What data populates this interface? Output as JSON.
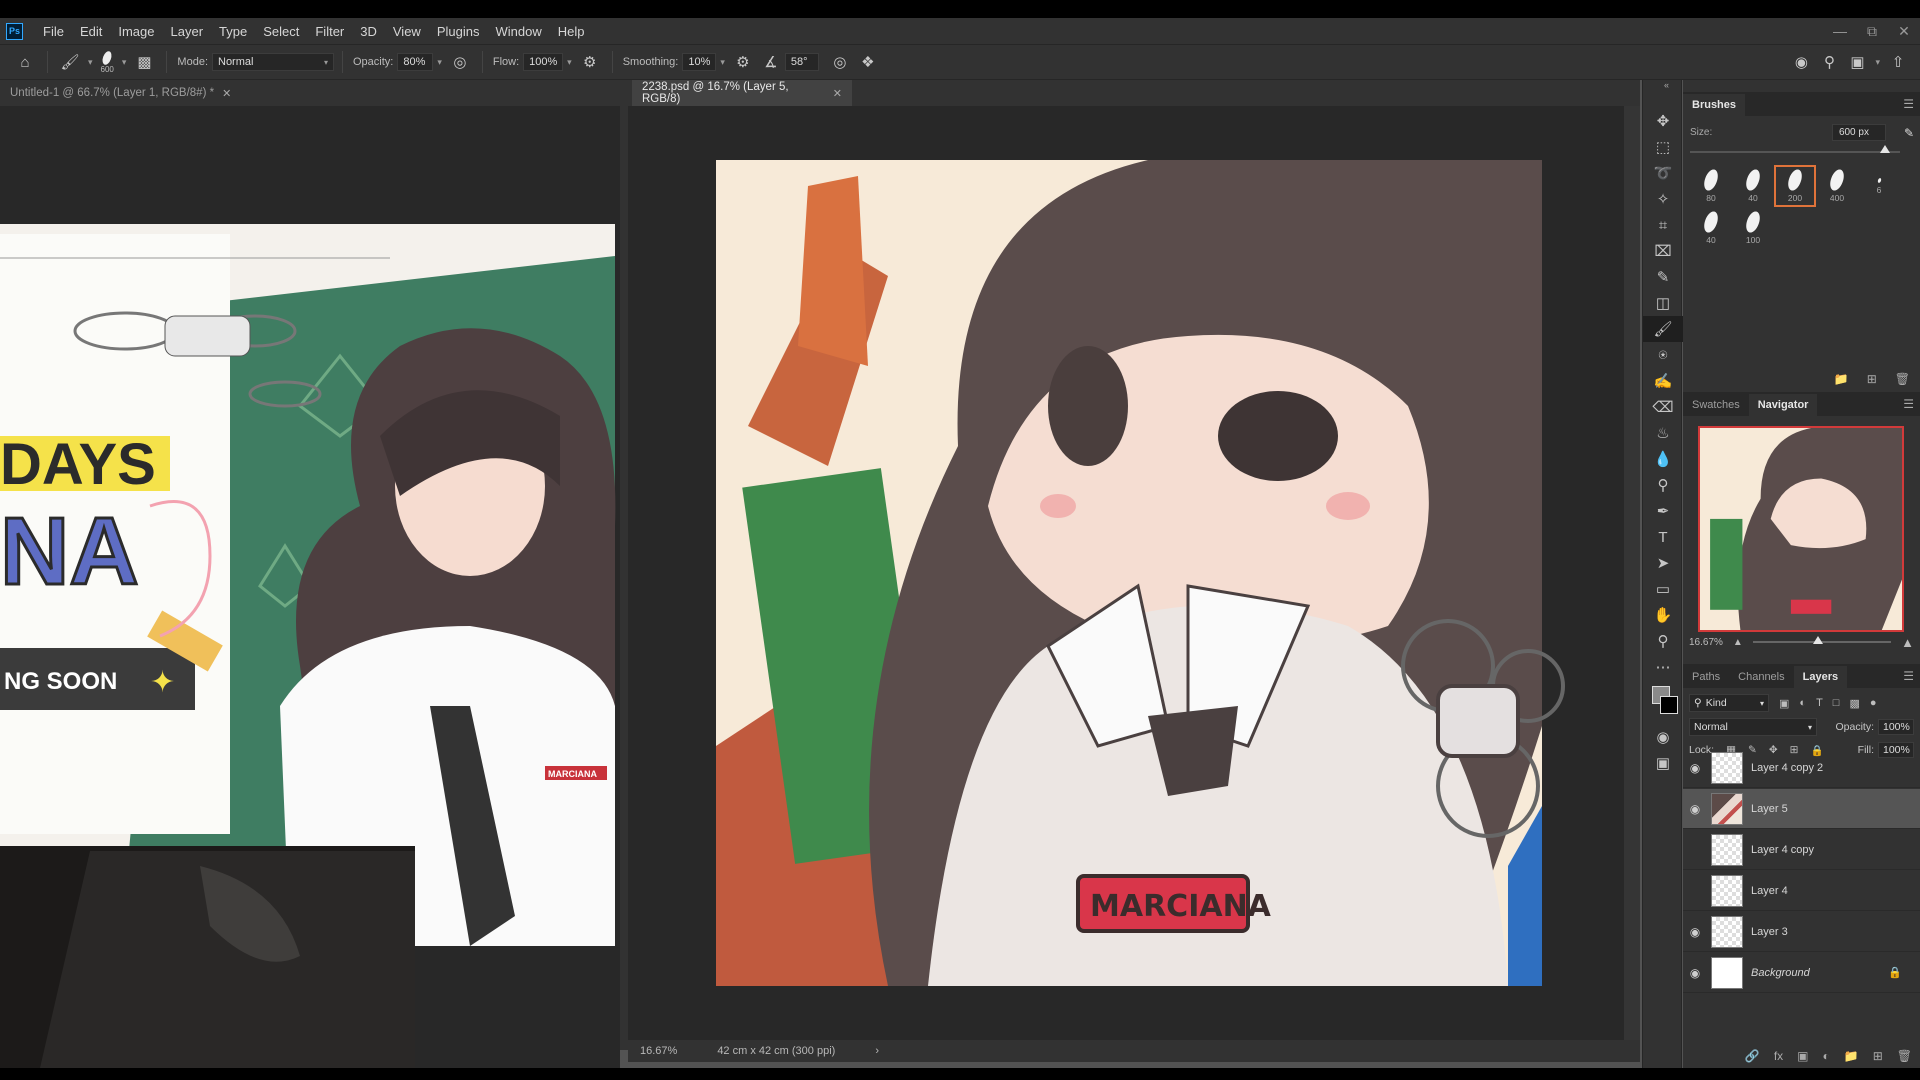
{
  "menu": {
    "logo": "Ps",
    "items": [
      "File",
      "Edit",
      "Image",
      "Layer",
      "Type",
      "Select",
      "Filter",
      "3D",
      "View",
      "Plugins",
      "Window",
      "Help"
    ]
  },
  "options": {
    "brush_size": "600",
    "mode_label": "Mode:",
    "mode_value": "Normal",
    "opacity_label": "Opacity:",
    "opacity_value": "80%",
    "flow_label": "Flow:",
    "flow_value": "100%",
    "smoothing_label": "Smoothing:",
    "smoothing_value": "10%",
    "angle_value": "58°"
  },
  "tabs": [
    {
      "label": "Untitled-1 @ 66.7% (Layer 1, RGB/8#) *"
    },
    {
      "label": "2238.psd @ 16.7% (Layer 5, RGB/8)"
    }
  ],
  "left_canvas": {
    "poster_line1": "DAYS",
    "poster_line2": "NA",
    "poster_line3": "NG SOON",
    "badge": "MARCIANA"
  },
  "main_canvas": {
    "badge": "MARCIANA"
  },
  "status": {
    "zoom": "16.67%",
    "doc_size": "42 cm x 42 cm (300 ppi)"
  },
  "brushes": {
    "title": "Brushes",
    "size_label": "Size:",
    "size_value": "600 px",
    "size_fraction": 0.93,
    "presets": [
      "80",
      "40",
      "200",
      "400",
      "6",
      "40",
      "100"
    ],
    "selected_index": 2
  },
  "navigator": {
    "tab_swatches": "Swatches",
    "tab_navigator": "Navigator",
    "zoom": "16.67%",
    "zoom_fraction": 0.47
  },
  "layers_panel": {
    "tab_paths": "Paths",
    "tab_channels": "Channels",
    "tab_layers": "Layers",
    "kind_label": "Kind",
    "blend_mode": "Normal",
    "opacity_label": "Opacity:",
    "opacity_value": "100%",
    "lock_label": "Lock:",
    "fill_label": "Fill:",
    "fill_value": "100%",
    "layers": [
      {
        "name": "Layer 4 copy 2",
        "visible": true
      },
      {
        "name": "Layer 5",
        "visible": true,
        "selected": true
      },
      {
        "name": "Layer 4 copy",
        "visible": false
      },
      {
        "name": "Layer 4",
        "visible": false
      },
      {
        "name": "Layer 3",
        "visible": true
      },
      {
        "name": "Background",
        "visible": true,
        "locked": true
      }
    ]
  },
  "colors": {
    "accent": "#e0733a",
    "panel_bg": "#323232",
    "canvas_bg": "#282828"
  }
}
